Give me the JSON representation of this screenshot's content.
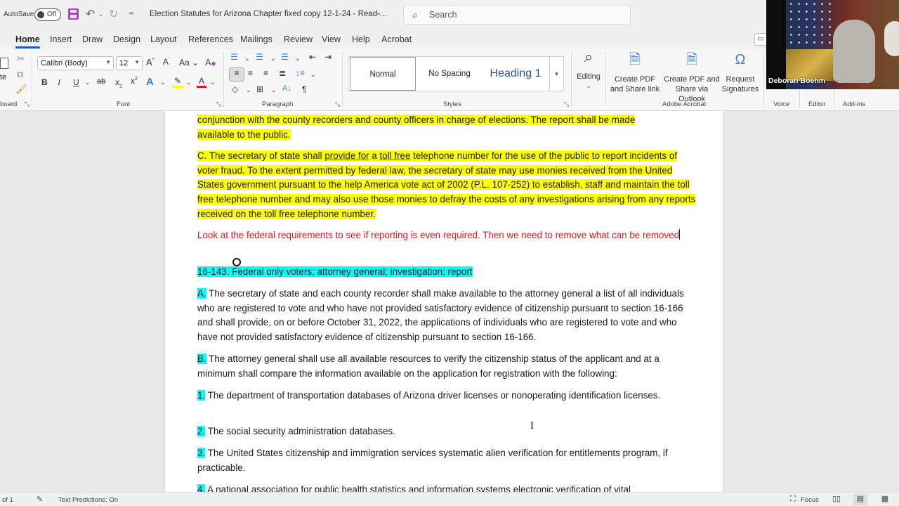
{
  "titlebar": {
    "autosave_label": "AutoSave",
    "autosave_state": "Off",
    "document_title": "Election Statutes for Arizona Chapter fixed copy 12-1-24  -  Read-...",
    "title_dropdown_icon": "chevron-down-icon",
    "search_placeholder": "Search"
  },
  "tabs": [
    {
      "label": "Home",
      "active": true
    },
    {
      "label": "Insert"
    },
    {
      "label": "Draw"
    },
    {
      "label": "Design"
    },
    {
      "label": "Layout"
    },
    {
      "label": "References"
    },
    {
      "label": "Mailings"
    },
    {
      "label": "Review"
    },
    {
      "label": "View"
    },
    {
      "label": "Help"
    },
    {
      "label": "Acrobat"
    }
  ],
  "ribbon": {
    "clipboard": {
      "label": "board",
      "paste_label": "te"
    },
    "font": {
      "label": "Font",
      "font_name": "Calibri (Body)",
      "font_size": "12"
    },
    "paragraph": {
      "label": "Paragraph"
    },
    "styles": {
      "label": "Styles",
      "items": [
        "Normal",
        "No Spacing",
        "Heading 1"
      ],
      "selected": "Normal"
    },
    "editing": {
      "label": "Editing"
    },
    "acrobat": {
      "label": "Adobe Acrobat",
      "buttons": [
        {
          "line1": "Create PDF",
          "line2": "and Share link"
        },
        {
          "line1": "Create PDF and",
          "line2": "Share via Outlook"
        },
        {
          "line1": "Request",
          "line2": "Signatures"
        }
      ]
    },
    "voice": {
      "label": "Voice"
    },
    "editor": {
      "label": "Editor"
    },
    "addins": {
      "label": "Add-ins"
    }
  },
  "video": {
    "participant_name": "Deborah Boehm"
  },
  "document": {
    "p1": {
      "line1": "conjunction with the county recorders and county officers in charge of elections. The report shall be made",
      "line2": "available to the public."
    },
    "p2": {
      "prefix": "C. The secretary of state shall ",
      "u1": "provide for",
      "mid": " a ",
      "u2": "toll free",
      "rest": " telephone number for the use of the public to report incidents of voter fraud.  To the extent permitted by federal law, the secretary of state may use monies received from the United States government pursuant to the help America vote act of 2002 (P.L. 107-252) to establish, staff and maintain the toll free telephone number and may also use those monies to defray the costs of any investigations arising from any reports received on the toll free telephone number."
    },
    "note": "Look at the federal requirements to see if reporting is even required. Then we need to remove what can be removed",
    "heading": "16-143. Federal only voters; attorney general; investigation; report",
    "items": [
      {
        "marker": "A.",
        "text": " The secretary of state and each county recorder shall make available to the attorney general a list of all individuals who are registered to vote and who have not provided satisfactory evidence of citizenship pursuant to section 16-166 and shall provide, on or before October 31, 2022, the applications of individuals who are registered to vote and who have not provided satisfactory evidence of citizenship pursuant to section 16-166."
      },
      {
        "marker": "B.",
        "text": " The attorney general shall use all available resources to verify the citizenship status of the applicant and at a minimum shall compare the information available on the application for registration with the following:"
      },
      {
        "marker": "1.",
        "text": " The department of transportation databases of Arizona driver licenses or nonoperating identification licenses."
      },
      {
        "marker": "2.",
        "text": " The social security administration databases."
      },
      {
        "marker": "3.",
        "text": " The United States citizenship and immigration services systematic alien verification for entitlements program, if practicable."
      },
      {
        "marker": "4.",
        "text": " A national association for public health statistics and information systems electronic verification of vital"
      }
    ]
  },
  "statusbar": {
    "page_info": "of 1",
    "text_predictions": "Text Predictions: On",
    "focus_label": "Focus"
  },
  "colors": {
    "highlight_yellow": "#ffff00",
    "highlight_cyan": "#00ffff",
    "note_red": "#e0141c",
    "tab_accent": "#185abd"
  }
}
